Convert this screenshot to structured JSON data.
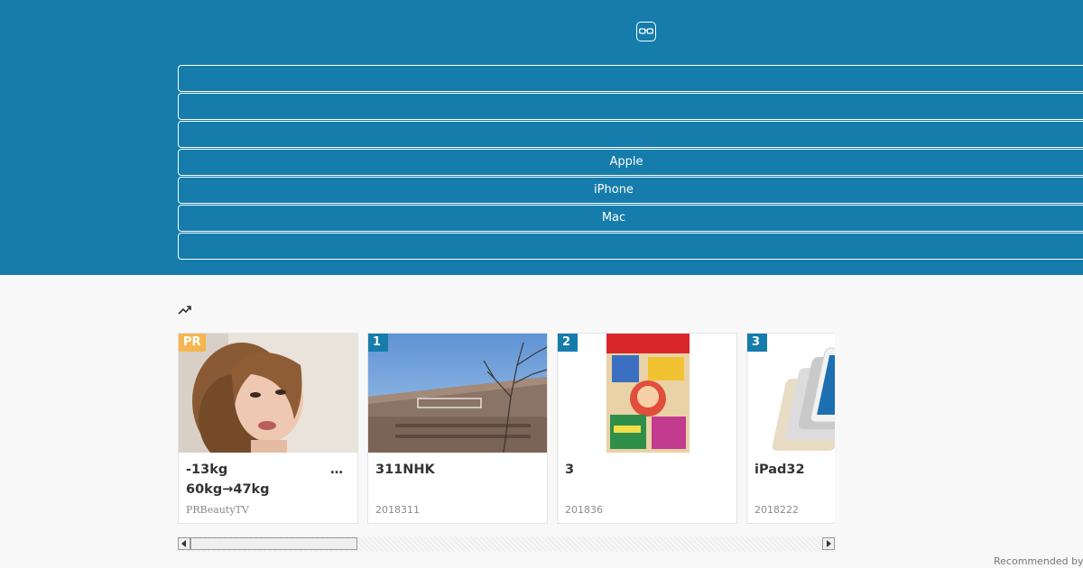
{
  "colors": {
    "header_bg": "#157cab",
    "page_bg": "#f8f8f8",
    "badge_pr": "#f5b550",
    "badge_rank": "#157cab"
  },
  "header": {
    "logo_icon": "glasses-icon",
    "nav": [
      {
        "label": ""
      },
      {
        "label": ""
      },
      {
        "label": ""
      },
      {
        "label": "Apple"
      },
      {
        "label": "iPhone"
      },
      {
        "label": "Mac"
      },
      {
        "label": ""
      }
    ]
  },
  "ranking": {
    "icon": "trending-up-icon",
    "cards": [
      {
        "badge": "PR",
        "title_line1": "-13kg",
        "title_line2": "60kg→47kg",
        "more": "…",
        "meta": "PRBeautyTV",
        "thumb": "woman-portrait"
      },
      {
        "badge": "1",
        "title_line1": "311NHK",
        "title_line2": "",
        "more": "",
        "meta": "2018311",
        "thumb": "nhk-building"
      },
      {
        "badge": "2",
        "title_line1": "3",
        "title_line2": "",
        "more": "",
        "meta": "201836",
        "thumb": "comic-cover"
      },
      {
        "badge": "3",
        "title_line1": "iPad32",
        "title_line2": "",
        "more": "",
        "meta": "2018222",
        "thumb": "ipad-devices"
      }
    ]
  },
  "footer": {
    "recommended": "Recommended by"
  }
}
